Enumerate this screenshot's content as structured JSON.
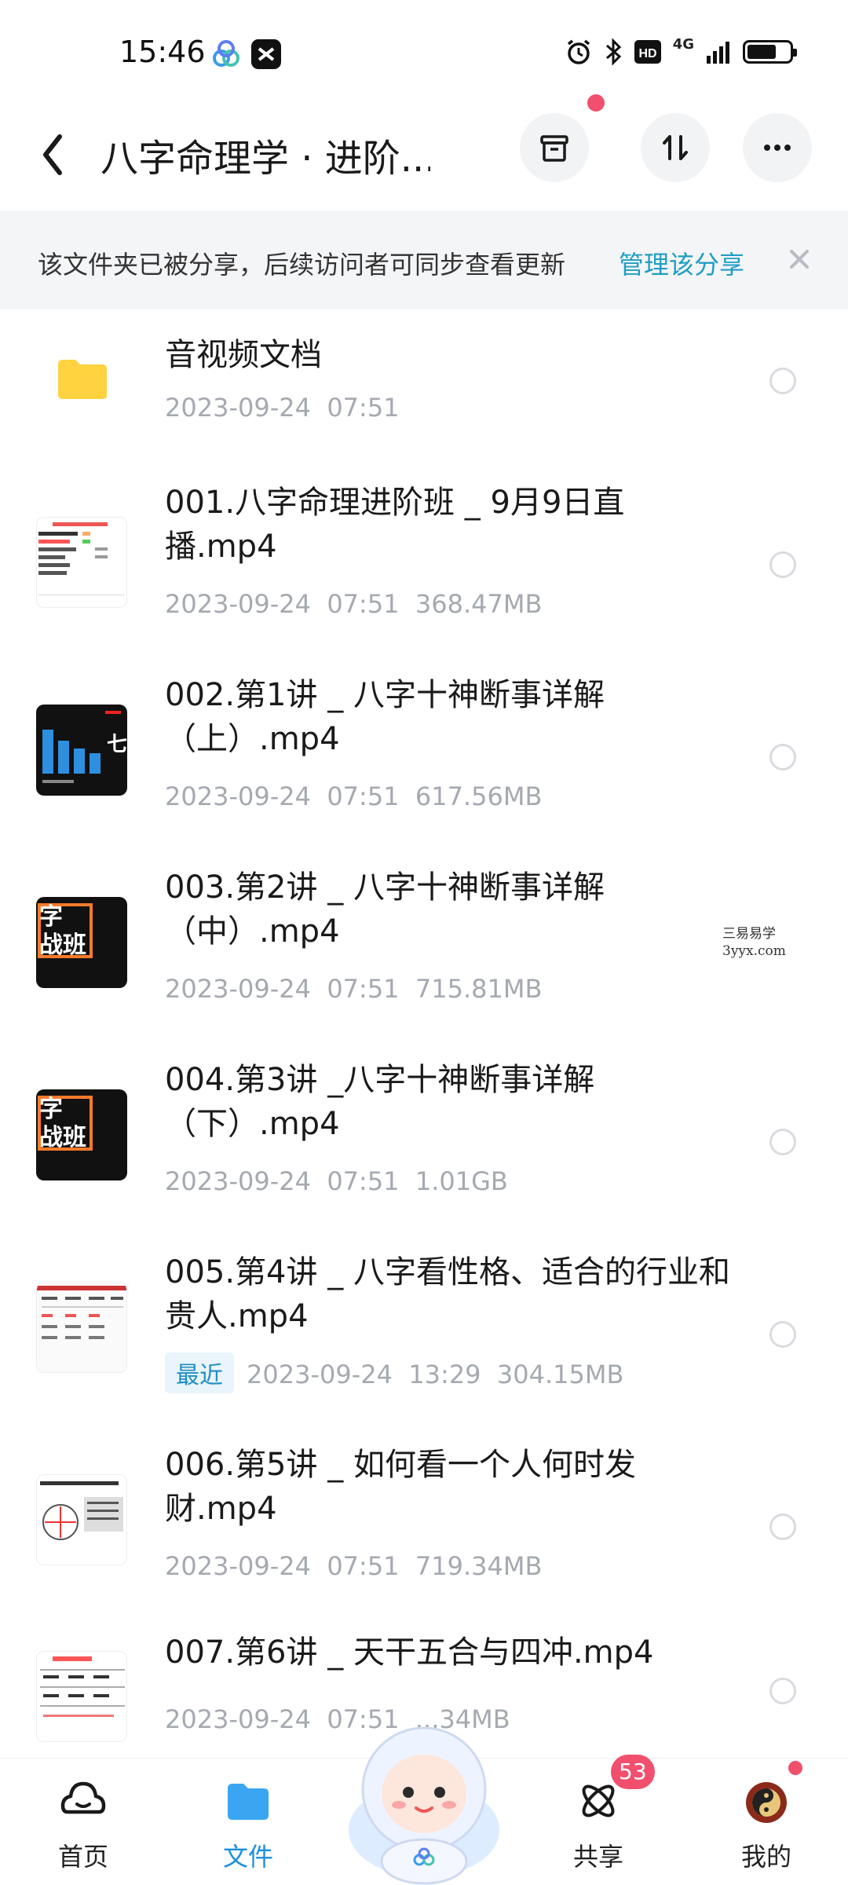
{
  "status_bar": {
    "time": "15:46",
    "network": "4G",
    "icons": [
      "cloud-app-icon",
      "capcut-icon",
      "alarm-icon",
      "bluetooth-icon",
      "hd-icon",
      "signal-icon",
      "battery-icon"
    ]
  },
  "header": {
    "title": "八字命理学 · 进阶...",
    "buttons": [
      "archive-icon",
      "sort-icon",
      "more-icon"
    ]
  },
  "banner": {
    "text": "该文件夹已被分享，后续访问者可同步查看更新",
    "link": "管理该分享"
  },
  "files": [
    {
      "name": "音视频文档",
      "date": "2023-09-24  07:51",
      "size": "",
      "type": "folder"
    },
    {
      "name": "001.八字命理进阶班 _ 9月9日直播.mp4",
      "date": "2023-09-24  07:51",
      "size": "368.47MB",
      "type": "video"
    },
    {
      "name": "002.第1讲 _ 八字十神断事详解（上）.mp4",
      "date": "2023-09-24  07:51",
      "size": "617.56MB",
      "type": "video"
    },
    {
      "name": "003.第2讲 _ 八字十神断事详解（中）.mp4",
      "date": "2023-09-24  07:51",
      "size": "715.81MB",
      "type": "video"
    },
    {
      "name": "004.第3讲 _八字十神断事详解（下）.mp4",
      "date": "2023-09-24  07:51",
      "size": "1.01GB",
      "type": "video"
    },
    {
      "name": "005.第4讲 _ 八字看性格、适合的行业和贵人.mp4",
      "tag": "最近",
      "date": "2023-09-24  13:29",
      "size": "304.15MB",
      "type": "video"
    },
    {
      "name": "006.第5讲 _ 如何看一个人何时发财.mp4",
      "date": "2023-09-24  07:51",
      "size": "719.34MB",
      "type": "video"
    },
    {
      "name": "007.第6讲 _ 天干五合与四冲.mp4",
      "date": "2023-09-24  07:51",
      "size": "...34MB",
      "type": "video"
    }
  ],
  "thumb_text": {
    "t3": "字\n战班",
    "t4": "字\n战班"
  },
  "watermark": {
    "line1": "三易易学",
    "line2": "3yyx.com"
  },
  "bottom_nav": {
    "items": [
      {
        "label": "首页",
        "icon": "home-icon"
      },
      {
        "label": "文件",
        "icon": "folder-icon"
      },
      {
        "label": "共享",
        "icon": "share-icon"
      },
      {
        "label": "我的",
        "icon": "avatar-icon"
      }
    ],
    "share_badge": "53"
  },
  "colors": {
    "accent": "#1f9ec4",
    "active_nav": "#1b8fe0",
    "badge": "#f0506e",
    "folder": "#ffd23f",
    "meta": "#a5a9b0"
  }
}
